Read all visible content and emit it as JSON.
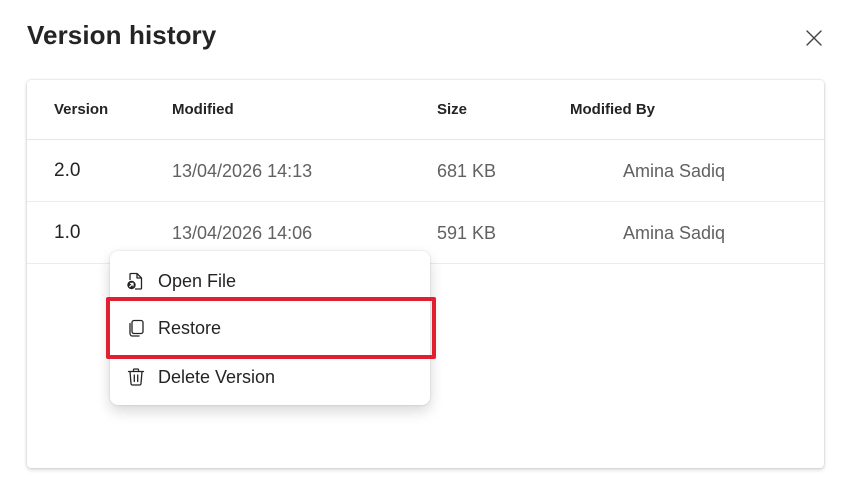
{
  "dialog": {
    "title": "Version history",
    "close_icon": "close-icon"
  },
  "table": {
    "headers": {
      "version": "Version",
      "modified": "Modified",
      "size": "Size",
      "modified_by": "Modified By"
    },
    "rows": [
      {
        "version": "2.0",
        "modified": "13/04/2026 14:13",
        "size": "681 KB",
        "modified_by": "Amina Sadiq"
      },
      {
        "version": "1.0",
        "modified": "13/04/2026 14:06",
        "size": "591 KB",
        "modified_by": "Amina Sadiq"
      }
    ]
  },
  "context_menu": {
    "items": [
      {
        "label": "Open File",
        "icon": "open-file-icon"
      },
      {
        "label": "Restore",
        "icon": "restore-icon"
      },
      {
        "label": "Delete Version",
        "icon": "trash-icon"
      }
    ]
  },
  "colors": {
    "highlight": "#e0202e",
    "text_primary": "#242424",
    "text_secondary": "#616161"
  }
}
